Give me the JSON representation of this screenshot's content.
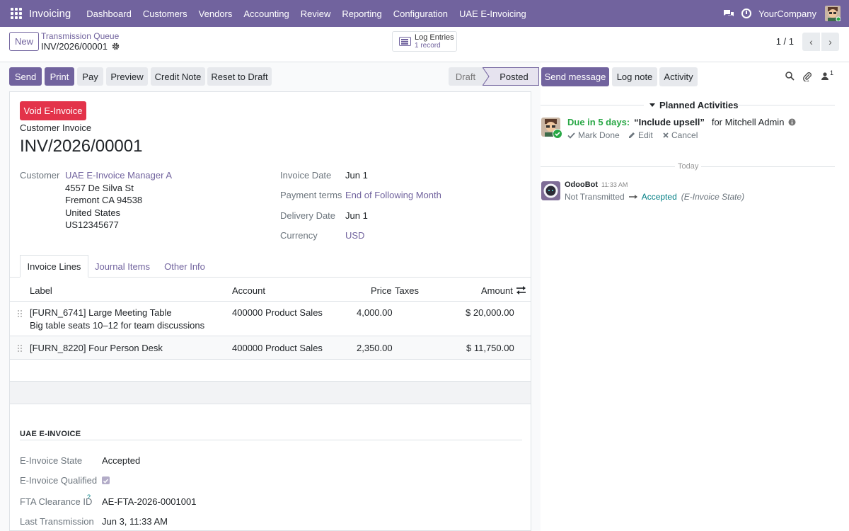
{
  "nav": {
    "app_name": "Invoicing",
    "items": [
      "Dashboard",
      "Customers",
      "Vendors",
      "Accounting",
      "Review",
      "Reporting",
      "Configuration",
      "UAE E-Invoicing"
    ],
    "company": "YourCompany"
  },
  "control": {
    "new_label": "New",
    "breadcrumb_parent": "Transmission Queue",
    "breadcrumb_current": "INV/2026/00001",
    "log_entries_title": "Log Entries",
    "log_entries_count": "1 record",
    "pager": "1 / 1"
  },
  "actions": {
    "send": "Send",
    "print": "Print",
    "pay": "Pay",
    "preview": "Preview",
    "credit_note": "Credit Note",
    "reset_to_draft": "Reset to Draft"
  },
  "status": {
    "draft": "Draft",
    "posted": "Posted",
    "current": "Posted"
  },
  "invoice": {
    "void_label": "Void E-Invoice",
    "type": "Customer Invoice",
    "number": "INV/2026/00001",
    "customer_label": "Customer",
    "customer_name": "UAE E-Invoice Manager A",
    "address_lines": [
      "4557 De Silva St",
      "Fremont CA 94538",
      "United States",
      "US12345677"
    ],
    "invoice_date_label": "Invoice Date",
    "invoice_date": "Jun 1",
    "payment_terms_label": "Payment terms",
    "payment_terms": "End of Following Month",
    "delivery_date_label": "Delivery Date",
    "delivery_date": "Jun 1",
    "currency_label": "Currency",
    "currency": "USD"
  },
  "tabs": [
    "Invoice Lines",
    "Journal Items",
    "Other Info"
  ],
  "table": {
    "headers": {
      "label": "Label",
      "account": "Account",
      "price": "Price",
      "taxes": "Taxes",
      "amount": "Amount"
    },
    "rows": [
      {
        "label": "[FURN_6741] Large Meeting Table",
        "description": "Big table seats 10–12 for team discussions",
        "account": "400000 Product Sales",
        "price": "4,000.00",
        "amount": "$ 20,000.00"
      },
      {
        "label": "[FURN_8220] Four Person Desk",
        "description": "",
        "account": "400000 Product Sales",
        "price": "2,350.00",
        "amount": "$ 11,750.00"
      }
    ]
  },
  "uae": {
    "section_title": "UAE E-INVOICE",
    "state_label": "E-Invoice State",
    "state": "Accepted",
    "qualified_label": "E-Invoice Qualified",
    "qualified": true,
    "fta_label": "FTA Clearance ID",
    "fta_help": "?",
    "fta_id": "AE-FTA-2026-0001001",
    "last_label": "Last Transmission",
    "last": "Jun 3, 11:33 AM"
  },
  "chatter": {
    "send_message": "Send message",
    "log_note": "Log note",
    "activity": "Activity",
    "followers_count": "1",
    "planned_title": "Planned Activities",
    "activity_due": "Due in 5 days:",
    "activity_summary": "“Include upsell”",
    "activity_for": "for Mitchell Admin",
    "mark_done": "Mark Done",
    "edit": "Edit",
    "cancel": "Cancel",
    "today": "Today",
    "msg_author": "OdooBot",
    "msg_time": "11:33 AM",
    "msg_old": "Not Transmitted",
    "msg_new": "Accepted",
    "msg_field": "(E-Invoice State)"
  },
  "colors": {
    "brand": "#71639e",
    "danger": "#e3334a",
    "success": "#28a745",
    "teal": "#017e84"
  }
}
